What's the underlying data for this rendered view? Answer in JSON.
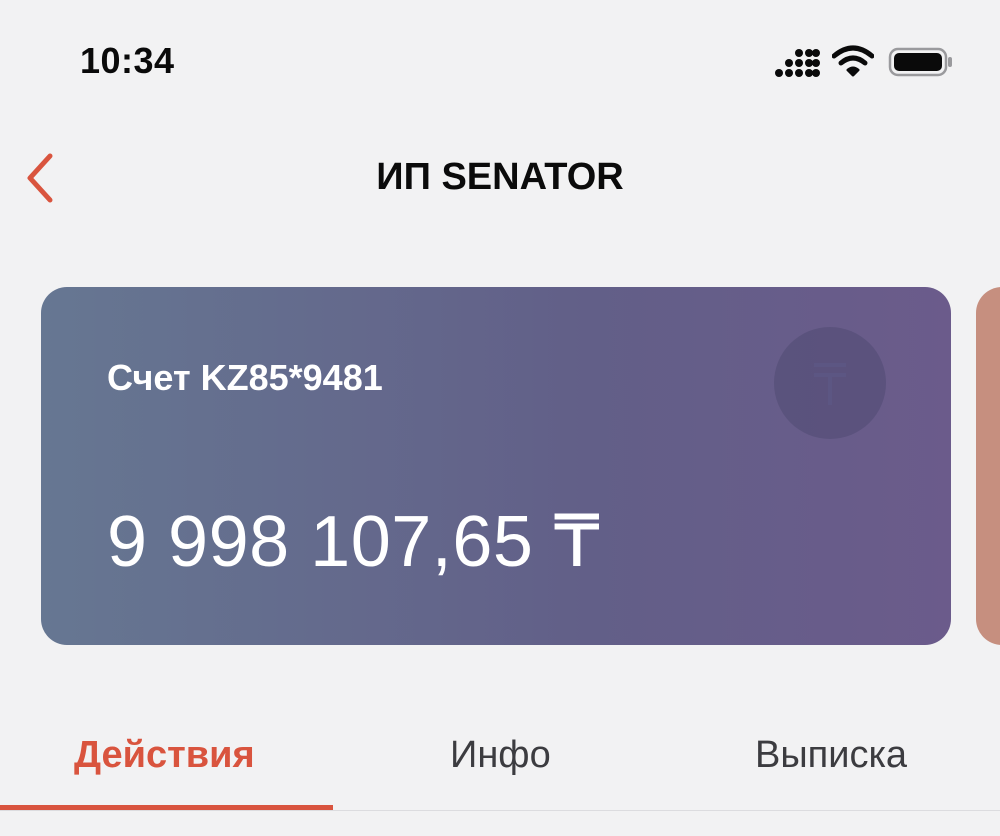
{
  "status_bar": {
    "time": "10:34"
  },
  "nav": {
    "title": "ИП SENATOR",
    "back_icon": "chevron-left-icon"
  },
  "account_card": {
    "label": "Счет KZ85*9481",
    "balance": "9 998 107,65 ₸",
    "currency_icon": "tenge-icon"
  },
  "tabs": [
    {
      "label": "Действия",
      "active": true
    },
    {
      "label": "Инфо",
      "active": false
    },
    {
      "label": "Выписка",
      "active": false
    }
  ],
  "colors": {
    "accent": "#d9543e",
    "card_gradient_start": "#667792",
    "card_gradient_end": "#6b5b8b",
    "next_card": "#c68f7f",
    "background": "#f2f2f3"
  }
}
